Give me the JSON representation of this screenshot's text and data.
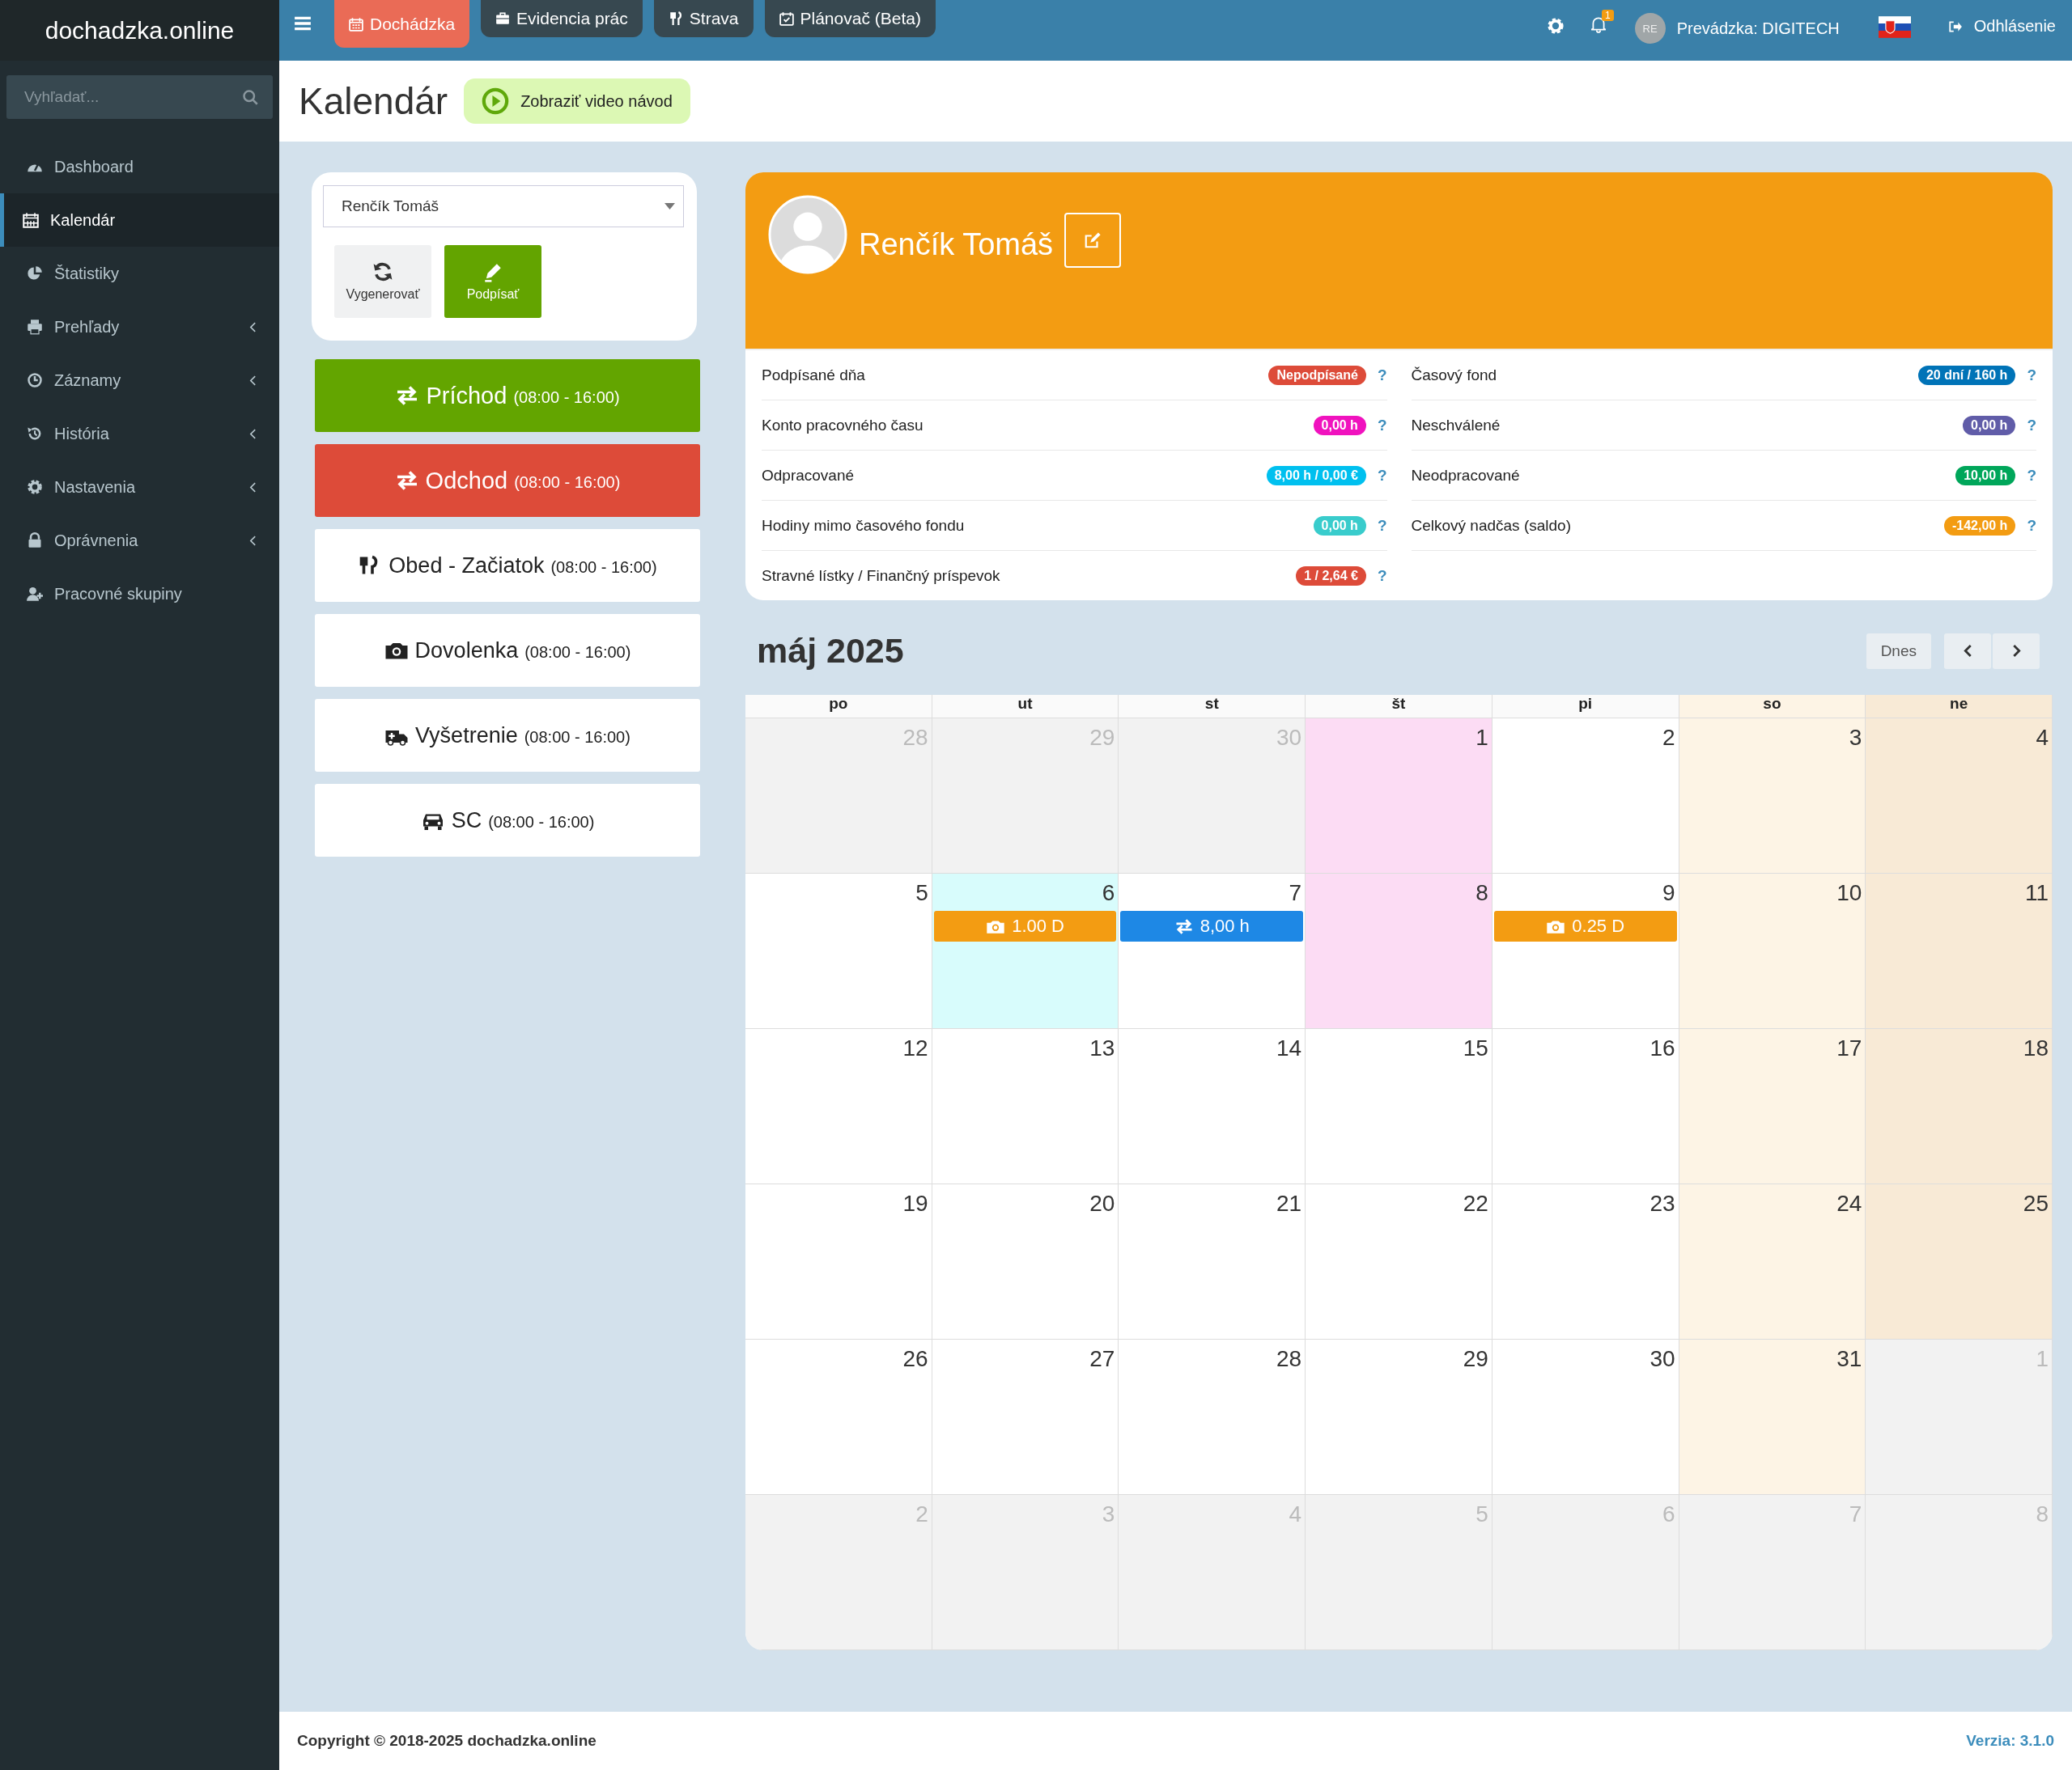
{
  "brand": "dochadzka.online",
  "top_tabs": [
    {
      "label": "Dochádzka",
      "selected": true
    },
    {
      "label": "Evidencia prác",
      "selected": false
    },
    {
      "label": "Strava",
      "selected": false
    },
    {
      "label": "Plánovač (Beta)",
      "selected": false
    }
  ],
  "top_right": {
    "notification_count": "1",
    "avatar_initials": "RE",
    "workplace": "Prevádzka: DIGITECH",
    "logout": "Odhlásenie"
  },
  "search": {
    "placeholder": "Vyhľadať..."
  },
  "sidebar": {
    "items": [
      {
        "label": "Dashboard",
        "selected": false,
        "expandable": false
      },
      {
        "label": "Kalendár",
        "selected": true,
        "expandable": false
      },
      {
        "label": "Štatistiky",
        "selected": false,
        "expandable": false
      },
      {
        "label": "Prehľady",
        "selected": false,
        "expandable": true
      },
      {
        "label": "Záznamy",
        "selected": false,
        "expandable": true
      },
      {
        "label": "História",
        "selected": false,
        "expandable": true
      },
      {
        "label": "Nastavenia",
        "selected": false,
        "expandable": true
      },
      {
        "label": "Oprávnenia",
        "selected": false,
        "expandable": true
      },
      {
        "label": "Pracovné skupiny",
        "selected": false,
        "expandable": false
      }
    ]
  },
  "page": {
    "title": "Kalendár",
    "video_button": "Zobraziť video návod"
  },
  "employee_select": {
    "value": "Renčík Tomáš"
  },
  "tool_buttons": [
    {
      "label": "Vygenerovať",
      "kind": "plain"
    },
    {
      "label": "Podpísať",
      "kind": "primary"
    }
  ],
  "actions": [
    {
      "label": "Príchod",
      "time": "(08:00 - 16:00)",
      "kind": "arrival"
    },
    {
      "label": "Odchod",
      "time": "(08:00 - 16:00)",
      "kind": "departure"
    },
    {
      "label": "Obed - Začiatok",
      "time": "(08:00 - 16:00)",
      "kind": "entry"
    },
    {
      "label": "Dovolenka",
      "time": "(08:00 - 16:00)",
      "kind": "entry"
    },
    {
      "label": "Vyšetrenie",
      "time": "(08:00 - 16:00)",
      "kind": "entry"
    },
    {
      "label": "SC",
      "time": "(08:00 - 16:00)",
      "kind": "entry"
    }
  ],
  "profile": {
    "name": "Renčík Tomáš"
  },
  "stats": {
    "left": [
      {
        "label": "Podpísané dňa",
        "value": "Nepodpísané",
        "color": "#dd4b39",
        "help": "?"
      },
      {
        "label": "Konto pracovného času",
        "value": "0,00 h",
        "color": "#f012be",
        "help": "?"
      },
      {
        "label": "Odpracované",
        "value": "8,00 h / 0,00 €",
        "color": "#00c0ef",
        "help": "?"
      },
      {
        "label": "Hodiny mimo časového fondu",
        "value": "0,00 h",
        "color": "#39cccc",
        "help": "?"
      },
      {
        "label": "Stravné lístky / Finančný príspevok",
        "value": "1 / 2,64 €",
        "color": "#dd4b39",
        "help": "?"
      }
    ],
    "right": [
      {
        "label": "Časový fond",
        "value": "20 dní / 160 h",
        "color": "#0073b7",
        "help": "?"
      },
      {
        "label": "Neschválené",
        "value": "0,00 h",
        "color": "#605ca8",
        "help": "?"
      },
      {
        "label": "Neodpracované",
        "value": "10,00 h",
        "color": "#00a65a",
        "help": "?"
      },
      {
        "label": "Celkový nadčas (saldo)",
        "value": "-142,00 h",
        "color": "#f39c12",
        "help": "?"
      }
    ]
  },
  "calendar": {
    "title": "máj 2025",
    "today_button": "Dnes",
    "weekdays": [
      "po",
      "ut",
      "st",
      "št",
      "pi",
      "so",
      "ne"
    ],
    "weeks": [
      [
        {
          "day": "28",
          "kind": "other"
        },
        {
          "day": "29",
          "kind": "other"
        },
        {
          "day": "30",
          "kind": "other"
        },
        {
          "day": "1",
          "kind": "holiday"
        },
        {
          "day": "2",
          "kind": "normal"
        },
        {
          "day": "3",
          "kind": "saturday"
        },
        {
          "day": "4",
          "kind": "sunday"
        }
      ],
      [
        {
          "day": "5",
          "kind": "normal"
        },
        {
          "day": "6",
          "kind": "highlight",
          "events": [
            {
              "kind": "absence",
              "text": "1.00 D"
            }
          ]
        },
        {
          "day": "7",
          "kind": "normal",
          "events": [
            {
              "kind": "attendance",
              "text": "8,00 h"
            }
          ]
        },
        {
          "day": "8",
          "kind": "holiday"
        },
        {
          "day": "9",
          "kind": "normal",
          "events": [
            {
              "kind": "absence",
              "text": "0.25 D"
            }
          ]
        },
        {
          "day": "10",
          "kind": "saturday"
        },
        {
          "day": "11",
          "kind": "sunday"
        }
      ],
      [
        {
          "day": "12",
          "kind": "normal"
        },
        {
          "day": "13",
          "kind": "normal"
        },
        {
          "day": "14",
          "kind": "normal"
        },
        {
          "day": "15",
          "kind": "normal"
        },
        {
          "day": "16",
          "kind": "normal"
        },
        {
          "day": "17",
          "kind": "saturday"
        },
        {
          "day": "18",
          "kind": "sunday"
        }
      ],
      [
        {
          "day": "19",
          "kind": "normal"
        },
        {
          "day": "20",
          "kind": "normal"
        },
        {
          "day": "21",
          "kind": "normal"
        },
        {
          "day": "22",
          "kind": "normal"
        },
        {
          "day": "23",
          "kind": "normal"
        },
        {
          "day": "24",
          "kind": "saturday"
        },
        {
          "day": "25",
          "kind": "sunday"
        }
      ],
      [
        {
          "day": "26",
          "kind": "normal"
        },
        {
          "day": "27",
          "kind": "normal"
        },
        {
          "day": "28",
          "kind": "normal"
        },
        {
          "day": "29",
          "kind": "normal"
        },
        {
          "day": "30",
          "kind": "normal"
        },
        {
          "day": "31",
          "kind": "saturday"
        },
        {
          "day": "1",
          "kind": "other"
        }
      ],
      [
        {
          "day": "2",
          "kind": "other"
        },
        {
          "day": "3",
          "kind": "other"
        },
        {
          "day": "4",
          "kind": "other"
        },
        {
          "day": "5",
          "kind": "other"
        },
        {
          "day": "6",
          "kind": "other"
        },
        {
          "day": "7",
          "kind": "other"
        },
        {
          "day": "8",
          "kind": "other"
        }
      ]
    ]
  },
  "footer": {
    "copyright": "Copyright © 2018-2025 dochadzka.online",
    "version": "Verzia: 3.1.0"
  }
}
